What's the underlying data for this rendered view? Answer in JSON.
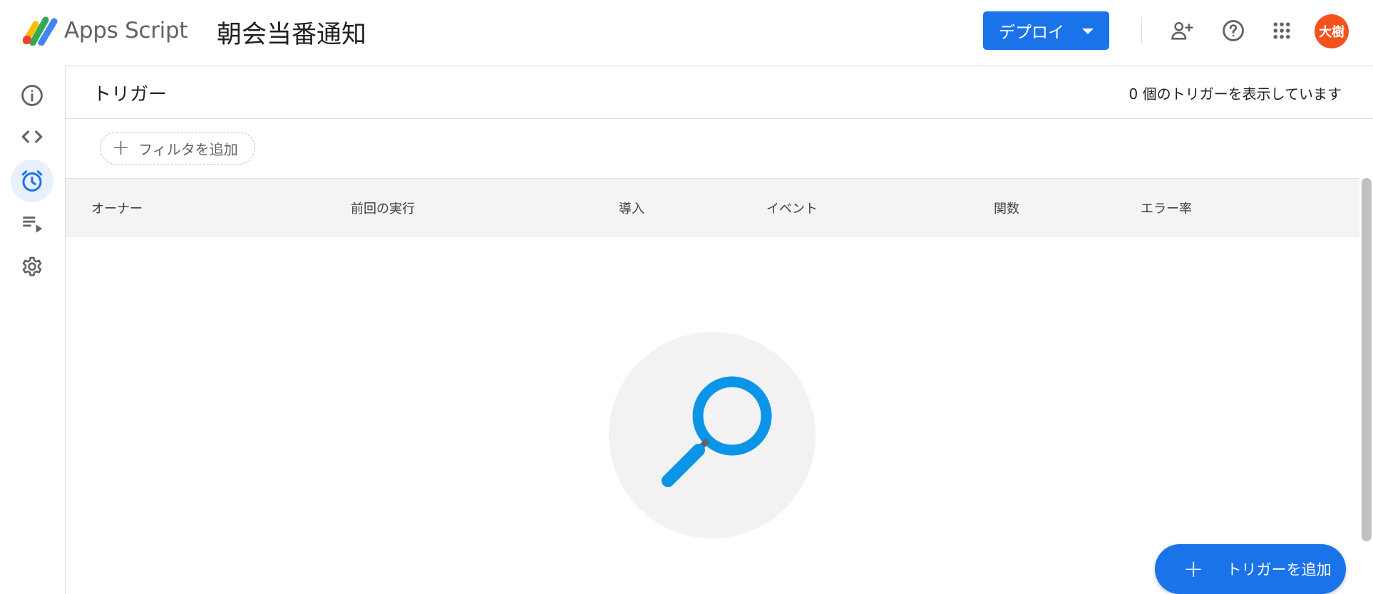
{
  "header": {
    "brand": "Apps Script",
    "project_title": "朝会当番通知",
    "deploy_label": "デプロイ",
    "avatar_text": "大樹",
    "icons": [
      "add-person-icon",
      "help-icon",
      "apps-grid-icon"
    ]
  },
  "sidebar": {
    "items": [
      {
        "name": "overview",
        "icon": "info-icon"
      },
      {
        "name": "editor",
        "icon": "code-icon"
      },
      {
        "name": "triggers",
        "icon": "alarm-icon",
        "active": true
      },
      {
        "name": "executions",
        "icon": "playlist-play-icon"
      },
      {
        "name": "settings",
        "icon": "gear-icon"
      }
    ]
  },
  "main": {
    "title": "トリガー",
    "count_text": "0 個のトリガーを表示しています",
    "filter_label": "フィルタを追加",
    "columns": [
      "オーナー",
      "前回の実行",
      "導入",
      "イベント",
      "関数",
      "エラー率"
    ],
    "empty_icon": "magnifier-icon",
    "add_trigger_label": "トリガーを追加"
  },
  "colors": {
    "accent": "#1a73e8",
    "avatar": "#f4511e",
    "magnifier": "#0b95e8"
  }
}
